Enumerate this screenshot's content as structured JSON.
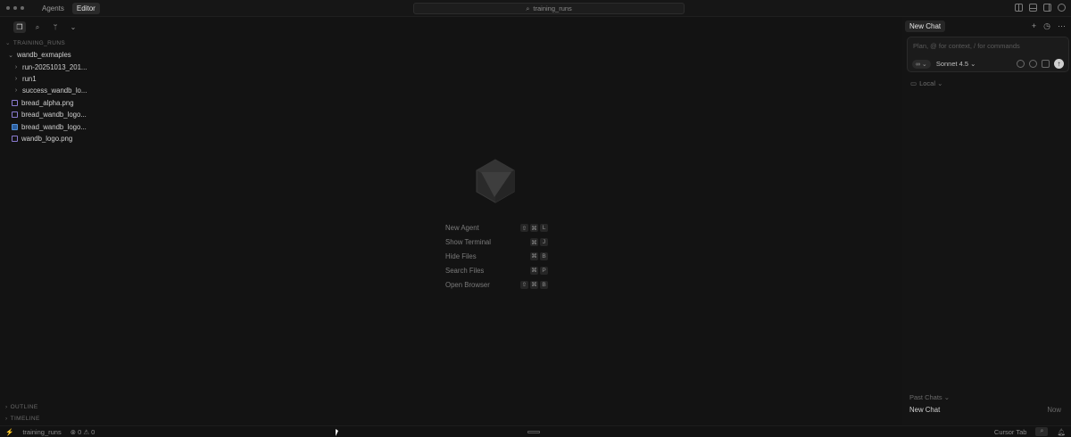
{
  "titlebar": {
    "tabs": [
      {
        "label": "Agents",
        "active": false
      },
      {
        "label": "Editor",
        "active": true
      }
    ],
    "search_text": "training_runs",
    "icon_names": [
      "split-left-icon",
      "split-bottom-icon",
      "split-right-icon",
      "settings-icon"
    ]
  },
  "sidebar": {
    "section_root": "TRAINING_RUNS",
    "tree": [
      {
        "label": "wandb_exmaples",
        "type": "folder",
        "expanded": true,
        "indent": 0
      },
      {
        "label": "run-20251013_201...",
        "type": "folder",
        "expanded": false,
        "indent": 1
      },
      {
        "label": "run1",
        "type": "folder",
        "expanded": false,
        "indent": 1
      },
      {
        "label": "success_wandb_lo...",
        "type": "folder",
        "expanded": false,
        "indent": 1
      },
      {
        "label": "bread_alpha.png",
        "type": "image",
        "indent": 0
      },
      {
        "label": "bread_wandb_logo...",
        "type": "image",
        "indent": 0
      },
      {
        "label": "bread_wandb_logo...",
        "type": "image-blue",
        "indent": 0
      },
      {
        "label": "wandb_logo.png",
        "type": "image",
        "indent": 0
      }
    ],
    "outline_label": "OUTLINE",
    "timeline_label": "TIMELINE"
  },
  "welcome": {
    "commands": [
      {
        "label": "New Agent",
        "keys": [
          "⇧",
          "⌘",
          "L"
        ]
      },
      {
        "label": "Show Terminal",
        "keys": [
          "⌘",
          "J"
        ]
      },
      {
        "label": "Hide Files",
        "keys": [
          "⌘",
          "B"
        ]
      },
      {
        "label": "Search Files",
        "keys": [
          "⌘",
          "P"
        ]
      },
      {
        "label": "Open Browser",
        "keys": [
          "⇧",
          "⌘",
          "B"
        ]
      }
    ]
  },
  "chat": {
    "tab_label": "New Chat",
    "placeholder": "Plan, @ for context, / for commands",
    "mode": "∞ ⌄",
    "model": "Sonnet 4.5 ⌄",
    "location": "Local ⌄",
    "past_header": "Past Chats ⌄",
    "past_items": [
      {
        "title": "New Chat",
        "time": "Now"
      }
    ]
  },
  "statusbar": {
    "branch": "training_runs",
    "problems": "⊗ 0 ⚠ 0",
    "cursor_tab": "Cursor Tab"
  },
  "colors": {
    "background": "#131313",
    "panel": "#141414",
    "accent_icon": "#8a7bd0"
  }
}
